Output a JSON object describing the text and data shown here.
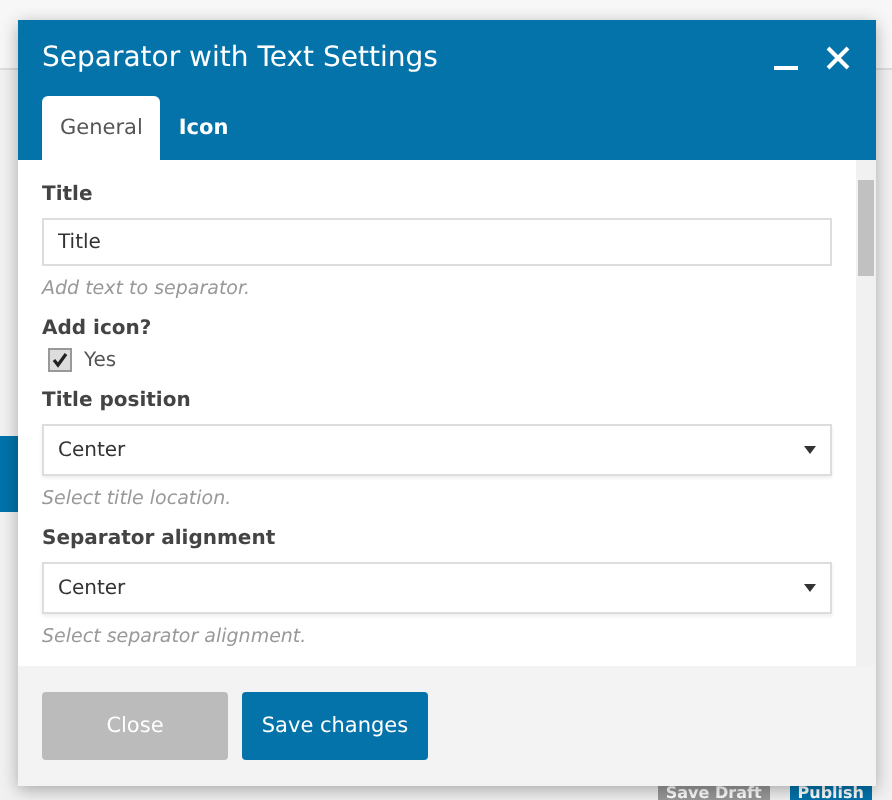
{
  "dialog": {
    "title": "Separator with Text Settings",
    "tabs": [
      {
        "label": "General",
        "selected": true
      },
      {
        "label": "Icon",
        "selected": false
      }
    ],
    "fields": [
      {
        "kind": "text",
        "label": "Title",
        "value": "Title",
        "hint": "Add text to separator."
      },
      {
        "kind": "checkbox",
        "label": "Add icon?",
        "option": "Yes",
        "checked": true
      },
      {
        "kind": "select",
        "label": "Title position",
        "value": "Center",
        "hint": "Select title location."
      },
      {
        "kind": "select",
        "label": "Separator alignment",
        "value": "Center",
        "hint": "Select separator alignment."
      }
    ],
    "buttons": [
      {
        "label": "Close",
        "kind": "secondary"
      },
      {
        "label": "Save changes",
        "kind": "primary"
      }
    ]
  },
  "page_buttons": [
    {
      "label": "Save Draft",
      "kind": "secondary"
    },
    {
      "label": "Publish",
      "kind": "primary"
    }
  ]
}
